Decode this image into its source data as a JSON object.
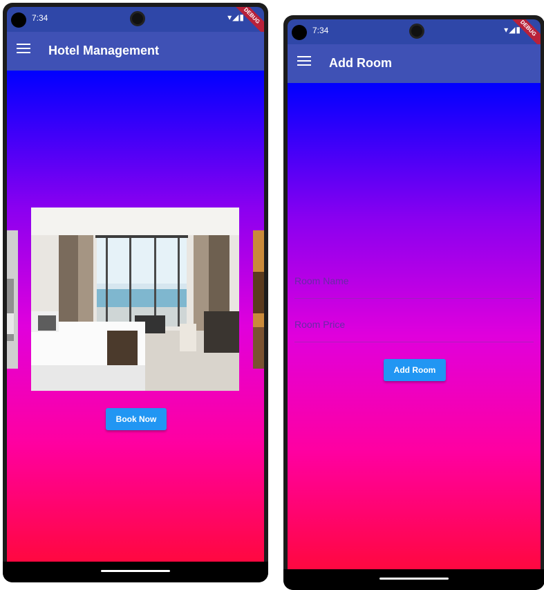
{
  "phone1": {
    "status": {
      "time": "7:34",
      "debug_label": "DEBUG"
    },
    "appbar": {
      "title": "Hotel Management"
    },
    "carousel": {
      "book_label": "Book Now"
    }
  },
  "phone2": {
    "status": {
      "time": "7:34",
      "debug_label": "DEBUG"
    },
    "appbar": {
      "title": "Add Room"
    },
    "form": {
      "room_name_placeholder": "Room Name",
      "room_price_placeholder": "Room Price",
      "submit_label": "Add Room"
    }
  },
  "colors": {
    "appbar": "#3f51b5",
    "status_bar": "#2f47a8",
    "button": "#2196f3",
    "gradient": [
      "#0000ff",
      "#8a00f0",
      "#e000dc",
      "#ff00a0",
      "#ff0840"
    ]
  }
}
